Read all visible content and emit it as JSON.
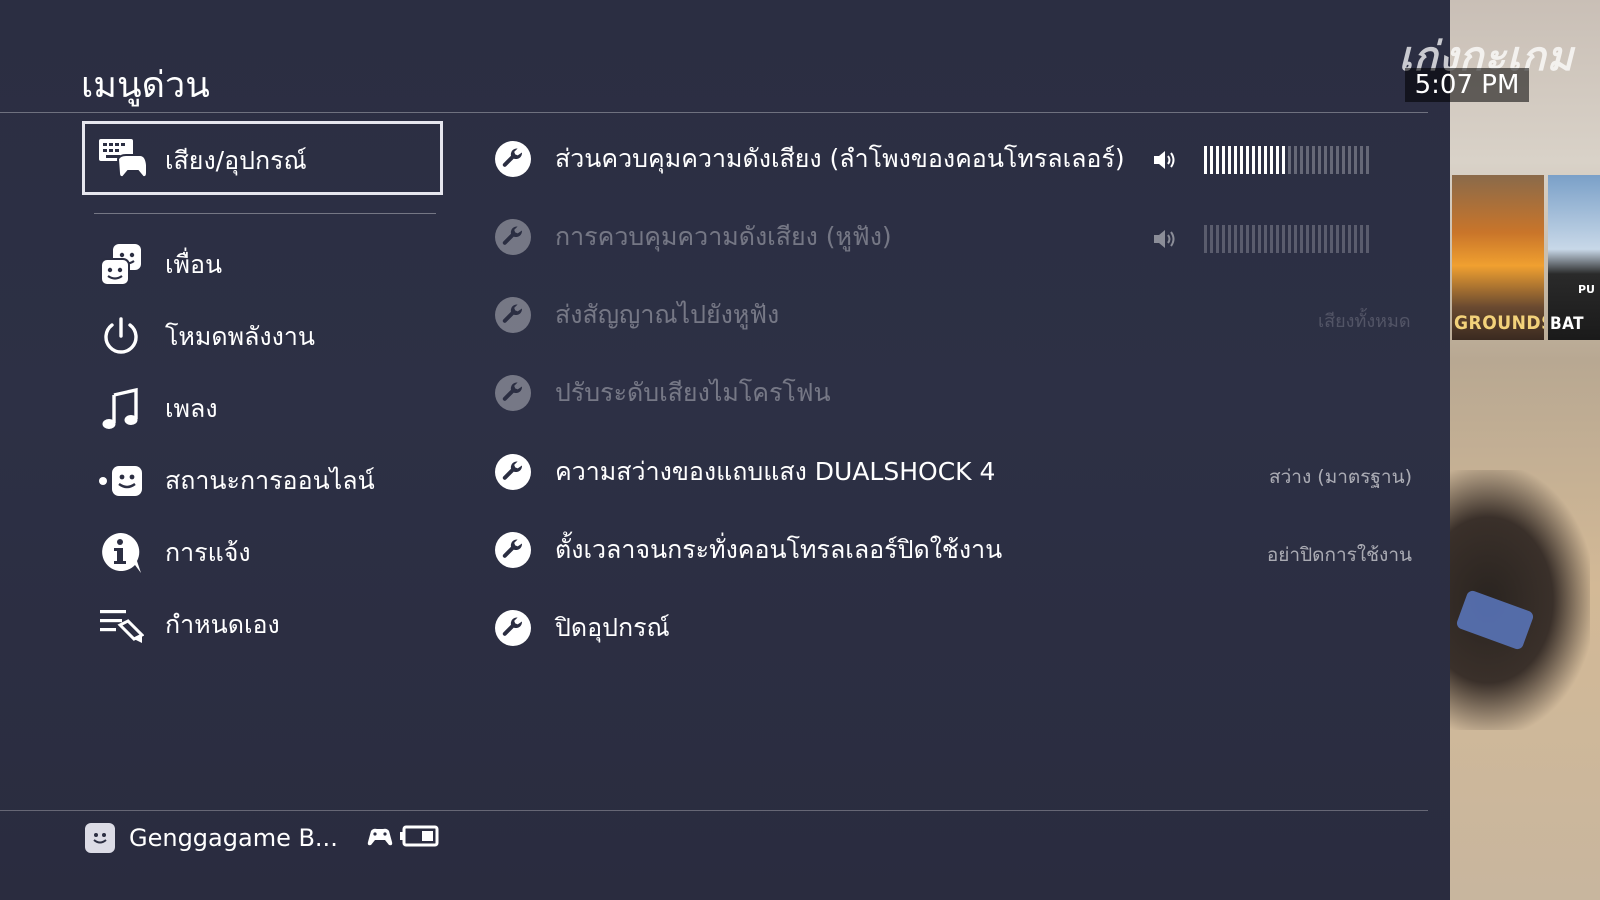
{
  "header": {
    "title": "เมนูด่วน",
    "brand": "เก่งกะเกม",
    "clock": "5:07 PM"
  },
  "menu": {
    "selected": {
      "label": "เสียง/อุปกรณ์",
      "icon": "keyboard-controller-icon"
    },
    "items": [
      {
        "label": "เพื่อน",
        "icon": "friends-icon"
      },
      {
        "label": "โหมดพลังงาน",
        "icon": "power-icon"
      },
      {
        "label": "เพลง",
        "icon": "music-note-icon"
      },
      {
        "label": "สถานะการออนไลน์",
        "icon": "online-status-icon"
      },
      {
        "label": "การแจ้ง",
        "icon": "info-icon"
      },
      {
        "label": "กำหนดเอง",
        "icon": "customize-icon"
      }
    ]
  },
  "options": [
    {
      "label": "ส่วนควบคุมความดังเสียง (ลำโพงของคอนโทรลเลอร์)",
      "enabled": true,
      "volume_level": 0.5
    },
    {
      "label": "การควบคุมความดังเสียง (หูฟัง)",
      "enabled": false,
      "volume_level": 0.0
    },
    {
      "label": "ส่งสัญญาณไปยังหูฟัง",
      "enabled": false
    },
    {
      "label": "ปรับระดับเสียงไมโครโฟน",
      "enabled": false
    },
    {
      "label": "ความสว่างของแถบแสง DUALSHOCK 4",
      "enabled": true,
      "value": "สว่าง (มาตรฐาน)"
    },
    {
      "label": "ตั้งเวลาจนกระทั่งคอนโทรลเลอร์ปิดใช้งาน",
      "enabled": true,
      "value": "อย่าปิดการใช้งาน"
    },
    {
      "label": "ปิดอุปกรณ์",
      "enabled": true
    }
  ],
  "background": {
    "ghost_label": "เสียงทั้งหมด",
    "tiles": [
      {
        "label": "GROUNDS"
      },
      {
        "top": "PU",
        "label": "BAT"
      }
    ]
  },
  "footer": {
    "username": "Genggagame B..."
  },
  "colors": {
    "panel": "#2b2e42",
    "text": "#ffffff",
    "disabled_text": "rgba(255,255,255,0.35)"
  }
}
